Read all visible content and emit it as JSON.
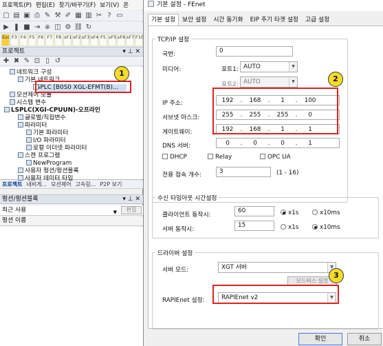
{
  "ide": {
    "menu": [
      "프로젝트(P)",
      "편집(E)",
      "찾기/바꾸기(F)",
      "보기(V)",
      "온"
    ],
    "fkeys": [
      {
        "k": "Esc",
        "l": ""
      },
      {
        "k": "F3",
        "l": ""
      },
      {
        "k": "F4",
        "l": ""
      },
      {
        "k": "F5",
        "l": ""
      },
      {
        "k": "F6",
        "l": ""
      },
      {
        "k": "F7",
        "l": ""
      },
      {
        "k": "F8",
        "l": ""
      },
      {
        "k": "sF1",
        "l": ""
      },
      {
        "k": "sF2",
        "l": ""
      },
      {
        "k": "sF3",
        "l": ""
      },
      {
        "k": "sF4",
        "l": ""
      },
      {
        "k": "F5",
        "l": ""
      },
      {
        "k": "sF5",
        "l": ""
      },
      {
        "k": "sF6",
        "l": ""
      },
      {
        "k": "sF7",
        "l": ""
      },
      {
        "k": "F10",
        "l": ""
      }
    ],
    "project_panel_title": "프로젝트",
    "tree": [
      "네트워크 구성",
      "기본 네트워크",
      "LSPLC [B0S0 XGL-EFMT(B)...",
      "모션제어 모듈",
      "시스템 변수",
      "LSPLC(XGI-CPUUN)-오프라인",
      "글로벌/직접변수",
      "파라미터",
      "기본 파라미터",
      "I/O 파라미터",
      "로컬 이더넷 파라미터",
      "스캔 프로그램",
      "NewProgram",
      "사용자 펑션/펑션블록",
      "사용자 데이터 타입"
    ],
    "bottom_tabs": [
      "프로젝트",
      "네비게...",
      "모션제어",
      "고속링...",
      "P2P 보기"
    ],
    "fb_panel_title": "펑션/펑션블록",
    "recent_label": "최근 사용",
    "edit_button": "편집",
    "name_column": "펑션 이름"
  },
  "dialog": {
    "title": "기본 설정 - FEnet",
    "tabs": [
      "기본 설정",
      "보안 설정",
      "시간 동기화",
      "EIP 주기 타겟 설정",
      "고급 설정"
    ],
    "tcpip_group": "TCP/IP 설정",
    "station_label": "국번:",
    "station_value": "0",
    "media_label": "미디어:",
    "port1_label": "포트1:",
    "port1_value": "AUTO",
    "port2_label": "포트2:",
    "port2_value": "AUTO",
    "ip_label": "IP 주소:",
    "ip": [
      "192",
      "168",
      "1",
      "100"
    ],
    "subnet_label": "서브넷 마스크:",
    "subnet": [
      "255",
      "255",
      "255",
      "0"
    ],
    "gateway_label": "게이트웨이:",
    "gateway": [
      "192",
      "168",
      "1",
      "1"
    ],
    "dns_label": "DNS 서버:",
    "dns": [
      "0",
      "0",
      "0",
      "1"
    ],
    "dhcp_label": "DHCP",
    "relay_label": "Relay",
    "opcua_label": "OPC UA",
    "conn_label": "전용 접속 개수:",
    "conn_value": "3",
    "conn_range": "(1 - 16)",
    "timeout_group": "수신 타임아웃 시간설정",
    "client_label": "클라이언트 동작시:",
    "client_value": "60",
    "client_unit1": "x1s",
    "client_unit2": "x10ms",
    "server_label": "서버 동작시:",
    "server_value": "15",
    "server_unit1": "x1s",
    "server_unit2": "x10ms",
    "driver_group": "드라이버 설정",
    "server_mode_label": "서버 모드:",
    "server_mode_value": "XGT 서버",
    "modbus_button": "모드버스 설정",
    "rapienet_label": "RAPIEnet 설정:",
    "rapienet_value": "RAPIEnet v2",
    "ok_button": "확인",
    "cancel_button": "취소"
  },
  "annotations": [
    "1",
    "2",
    "3"
  ],
  "colors": {
    "annotation_red": "#e02020",
    "callout_yellow": "#f6dc2a"
  }
}
